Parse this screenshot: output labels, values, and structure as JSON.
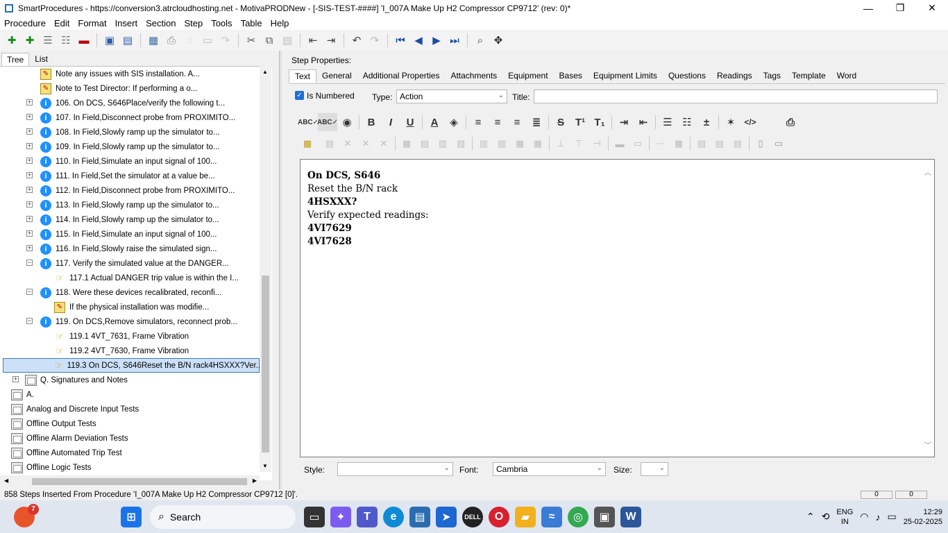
{
  "window": {
    "title": "SmartProcedures - https://conversion3.atrcloudhosting.net - MotivaPRODNew - [-SIS-TEST-####] 'I_007A Make Up H2 Compressor CP9712' (rev: 0)*",
    "minimize": "—",
    "maximize": "❐",
    "close": "✕"
  },
  "menu": [
    "Procedure",
    "Edit",
    "Format",
    "Insert",
    "Section",
    "Step",
    "Tools",
    "Table",
    "Help"
  ],
  "left_tabs": [
    "Tree",
    "List"
  ],
  "tree": [
    {
      "type": "note",
      "text": "Note any issues with SIS installation. A..."
    },
    {
      "type": "note",
      "text": "Note to Test Director: If performing a o..."
    },
    {
      "type": "info",
      "exp": "+",
      "text": "106. On DCS, S646Place/verify the following t..."
    },
    {
      "type": "info",
      "exp": "+",
      "text": "107. In Field,Disconnect probe from PROXIMITO..."
    },
    {
      "type": "info",
      "exp": "+",
      "text": "108. In Field,Slowly ramp up the simulator to..."
    },
    {
      "type": "info",
      "exp": "+",
      "text": "109. In Field,Slowly ramp up the simulator to..."
    },
    {
      "type": "info",
      "exp": "+",
      "text": "110. In Field,Simulate an input signal of 100..."
    },
    {
      "type": "info",
      "exp": "+",
      "text": "111. In Field,Set the simulator at a value be..."
    },
    {
      "type": "info",
      "exp": "+",
      "text": "112. In Field,Disconnect probe from PROXIMITO..."
    },
    {
      "type": "info",
      "exp": "+",
      "text": "113. In Field,Slowly ramp up the simulator to..."
    },
    {
      "type": "info",
      "exp": "+",
      "text": "114. In Field,Slowly ramp up the simulator to..."
    },
    {
      "type": "info",
      "exp": "+",
      "text": "115. In Field,Simulate an input signal of 100..."
    },
    {
      "type": "info",
      "exp": "+",
      "text": "116. In Field,Slowly raise the simulated sign..."
    },
    {
      "type": "info",
      "exp": "−",
      "text": "117. Verify the simulated value at the DANGER..."
    },
    {
      "type": "hand",
      "text": "117.1 Actual DANGER trip value is within the I..."
    },
    {
      "type": "info",
      "exp": "−",
      "text": "118. Were these devices recalibrated, reconfi..."
    },
    {
      "type": "note",
      "text": "If the physical installation was modifie..."
    },
    {
      "type": "info",
      "exp": "−",
      "text": "119. On DCS,Remove simulators, reconnect prob..."
    },
    {
      "type": "hand",
      "text": "119.1 4VT_7631, Frame Vibration"
    },
    {
      "type": "hand",
      "text": "119.2 4VT_7630, Frame Vibration"
    },
    {
      "type": "hand",
      "text": "119.3 On DCS, S646Reset the B/N rack4HSXXX?Ver...",
      "selected": true
    },
    {
      "type": "folder",
      "exp": "+",
      "text": "Q. Signatures and Notes"
    },
    {
      "type": "folder",
      "text": "A."
    },
    {
      "type": "folder",
      "text": "Analog and Discrete Input Tests"
    },
    {
      "type": "folder",
      "text": "Offline Output Tests"
    },
    {
      "type": "folder",
      "text": "Offline Alarm Deviation Tests"
    },
    {
      "type": "folder",
      "text": "Offline Automated Trip Test"
    },
    {
      "type": "folder",
      "text": "Offline Logic Tests"
    }
  ],
  "step_properties": {
    "header": "Step Properties:",
    "tabs": [
      "Text",
      "General",
      "Additional Properties",
      "Attachments",
      "Equipment",
      "Bases",
      "Equipment Limits",
      "Questions",
      "Readings",
      "Tags",
      "Template",
      "Word"
    ],
    "is_numbered_label": "Is Numbered",
    "type_label": "Type:",
    "type_value": "Action",
    "title_label": "Title:",
    "title_value": ""
  },
  "editor_lines": [
    {
      "text": "On DCS, S646",
      "bold": true
    },
    {
      "text": "Reset the B/N rack",
      "bold": false
    },
    {
      "text": "4HSXXX?",
      "bold": true
    },
    {
      "text": "Verify expected readings:",
      "bold": false
    },
    {
      "text": "4VI7629",
      "bold": true
    },
    {
      "text": "4VI7628",
      "bold": true
    }
  ],
  "bottom": {
    "style_label": "Style:",
    "style_value": "",
    "font_label": "Font:",
    "font_value": "Cambria",
    "size_label": "Size:",
    "size_value": ""
  },
  "status": {
    "text": "858 Steps Inserted From Procedure 'I_007A Make Up H2 Compressor CP9712 [0]'.",
    "box1": "0",
    "box2": "0"
  },
  "taskbar": {
    "badge": "7",
    "search_label": "Search",
    "lang1": "ENG",
    "lang2": "IN",
    "time": "12:29",
    "date": "25-02-2025"
  }
}
